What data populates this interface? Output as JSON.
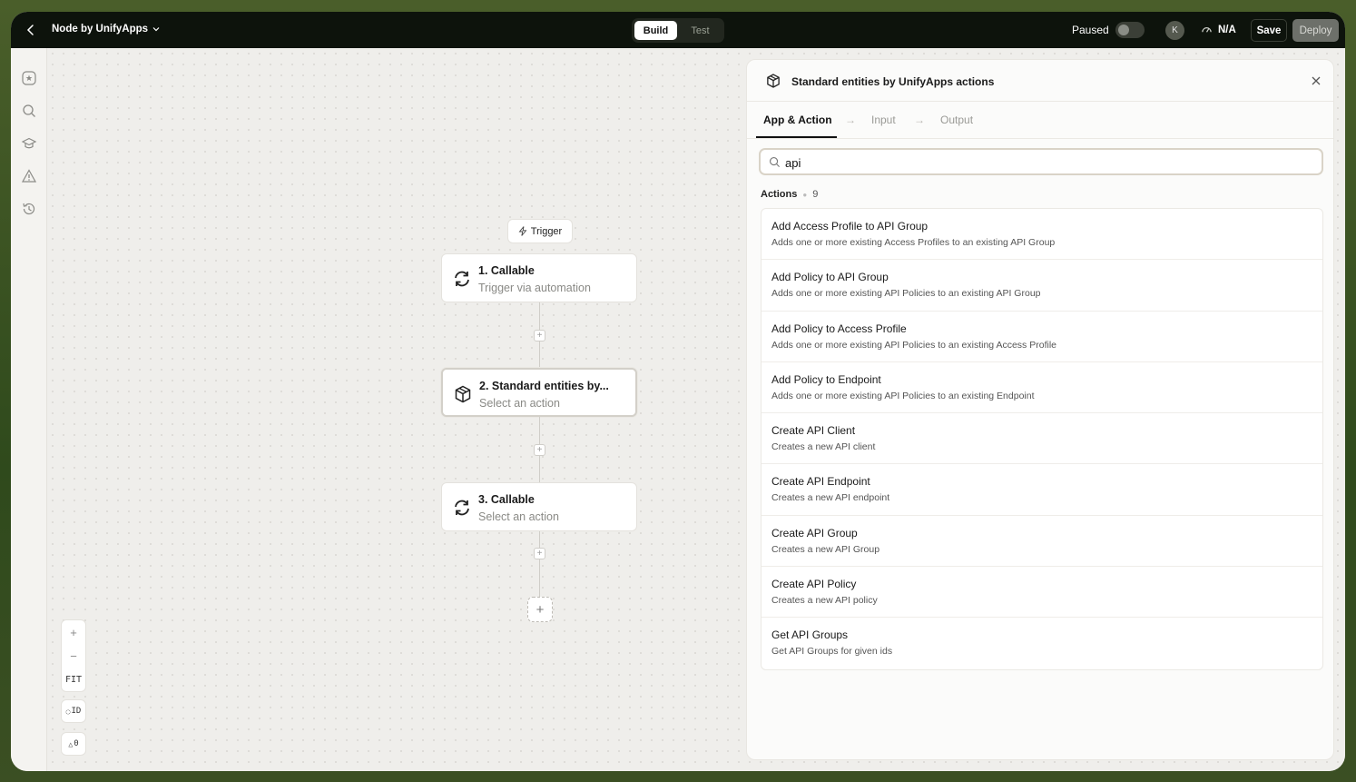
{
  "app": {
    "title": "Node by UnifyApps",
    "modes": [
      "Build",
      "Test"
    ],
    "active_mode": "Build",
    "status_label": "Paused",
    "avatar_initial": "K",
    "metric": "N/A",
    "save_label": "Save",
    "deploy_label": "Deploy"
  },
  "canvas": {
    "trigger_label": "Trigger",
    "nodes": [
      {
        "title": "1. Callable",
        "subtitle": "Trigger via automation",
        "icon": "refresh-icon"
      },
      {
        "title": "2. Standard entities by...",
        "subtitle": "Select an action",
        "icon": "cube-icon"
      },
      {
        "title": "3. Callable",
        "subtitle": "Select an action",
        "icon": "refresh-icon"
      }
    ],
    "zoom": {
      "in": "+",
      "out": "−",
      "fit": "FIT"
    },
    "id_toggle": "ID",
    "warnings": "0"
  },
  "panel": {
    "title": "Standard entities by UnifyApps actions",
    "tabs": [
      "App & Action",
      "Input",
      "Output"
    ],
    "search_value": "api",
    "section_label": "Actions",
    "section_count": "9",
    "actions": [
      {
        "title": "Add Access Profile to API Group",
        "desc": "Adds one or more existing Access Profiles to an existing API Group"
      },
      {
        "title": "Add Policy to API Group",
        "desc": "Adds one or more existing API Policies to an existing API Group"
      },
      {
        "title": "Add Policy to Access Profile",
        "desc": "Adds one or more existing API Policies to an existing Access Profile"
      },
      {
        "title": "Add Policy to Endpoint",
        "desc": "Adds one or more existing API Policies to an existing Endpoint"
      },
      {
        "title": "Create API Client",
        "desc": "Creates a new API client"
      },
      {
        "title": "Create API Endpoint",
        "desc": "Creates a new API endpoint"
      },
      {
        "title": "Create API Group",
        "desc": "Creates a new API Group"
      },
      {
        "title": "Create API Policy",
        "desc": "Creates a new API policy"
      },
      {
        "title": "Get API Groups",
        "desc": "Get API Groups for given ids"
      }
    ]
  },
  "colors": {
    "topbar": "#0d130c",
    "canvas": "#efeeeb",
    "accent": "#111111"
  }
}
